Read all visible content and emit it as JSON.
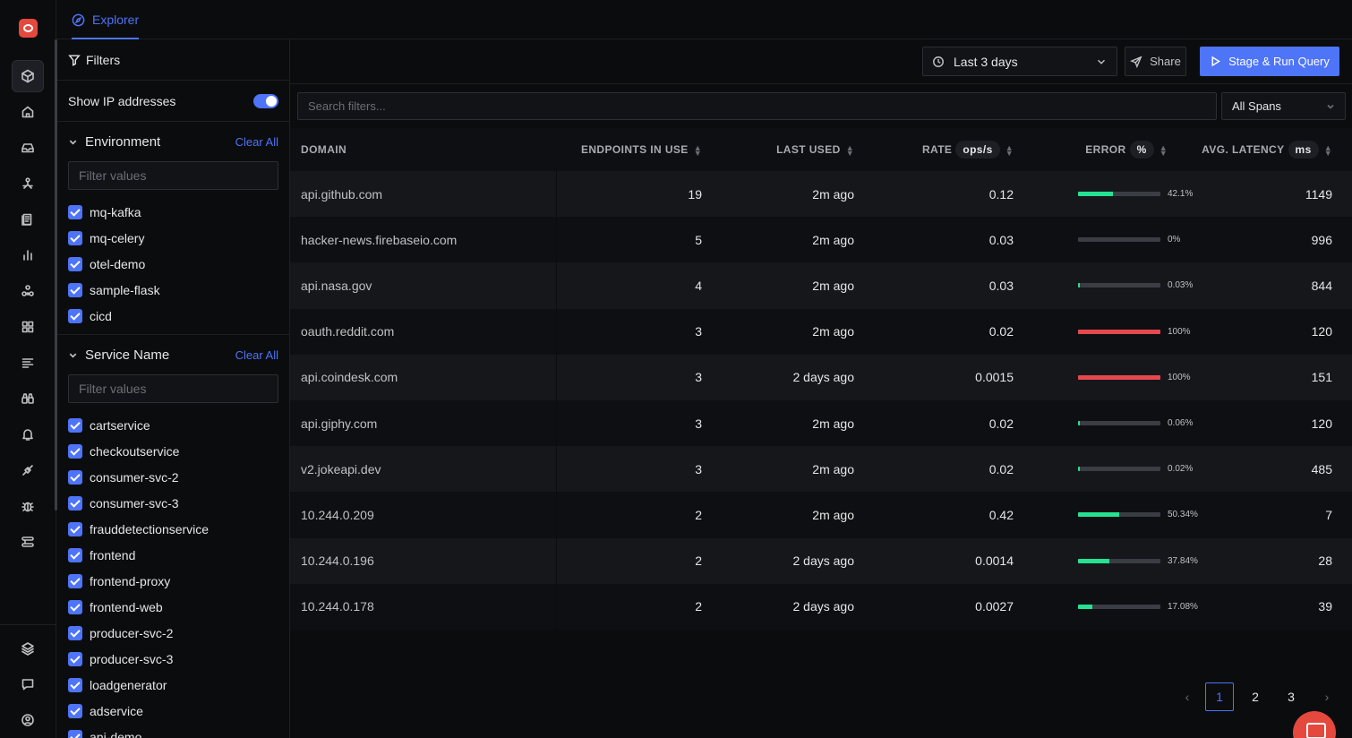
{
  "header": {
    "tab_label": "Explorer"
  },
  "filters": {
    "title": "Filters",
    "show_ip_label": "Show IP addresses",
    "show_ip_enabled": true,
    "environment": {
      "title": "Environment",
      "clear_label": "Clear All",
      "placeholder": "Filter values",
      "items": [
        "mq-kafka",
        "mq-celery",
        "otel-demo",
        "sample-flask",
        "cicd"
      ]
    },
    "service": {
      "title": "Service Name",
      "clear_label": "Clear All",
      "placeholder": "Filter values",
      "items": [
        "cartservice",
        "checkoutservice",
        "consumer-svc-2",
        "consumer-svc-3",
        "frauddetectionservice",
        "frontend",
        "frontend-proxy",
        "frontend-web",
        "producer-svc-2",
        "producer-svc-3",
        "loadgenerator",
        "adservice",
        "api-demo"
      ]
    }
  },
  "toolbar": {
    "time_range": "Last 3 days",
    "share_label": "Share",
    "run_label": "Stage & Run Query",
    "search_placeholder": "Search filters...",
    "spans_select": "All Spans"
  },
  "table": {
    "columns": {
      "domain": "DOMAIN",
      "endpoints": "ENDPOINTS IN USE",
      "last_used": "LAST USED",
      "rate": "RATE",
      "rate_unit": "ops/s",
      "error": "ERROR",
      "error_unit": "%",
      "latency": "AVG. LATENCY",
      "latency_unit": "ms"
    },
    "rows": [
      {
        "domain": "api.github.com",
        "endpoints": "19",
        "last_used": "2m ago",
        "rate": "0.12",
        "error": "42.1%",
        "error_frac": 0.421,
        "error_color": "#25e192",
        "latency": "1149"
      },
      {
        "domain": "hacker-news.firebaseio.com",
        "endpoints": "5",
        "last_used": "2m ago",
        "rate": "0.03",
        "error": "0%",
        "error_frac": 0,
        "error_color": "#25e192",
        "latency": "996"
      },
      {
        "domain": "api.nasa.gov",
        "endpoints": "4",
        "last_used": "2m ago",
        "rate": "0.03",
        "error": "0.03%",
        "error_frac": 0.0003,
        "error_color": "#25e192",
        "latency": "844"
      },
      {
        "domain": "oauth.reddit.com",
        "endpoints": "3",
        "last_used": "2m ago",
        "rate": "0.02",
        "error": "100%",
        "error_frac": 1,
        "error_color": "#e5484d",
        "latency": "120"
      },
      {
        "domain": "api.coindesk.com",
        "endpoints": "3",
        "last_used": "2 days ago",
        "rate": "0.0015",
        "error": "100%",
        "error_frac": 1,
        "error_color": "#e5484d",
        "latency": "151"
      },
      {
        "domain": "api.giphy.com",
        "endpoints": "3",
        "last_used": "2m ago",
        "rate": "0.02",
        "error": "0.06%",
        "error_frac": 0.006,
        "error_color": "#25e192",
        "latency": "120"
      },
      {
        "domain": "v2.jokeapi.dev",
        "endpoints": "3",
        "last_used": "2m ago",
        "rate": "0.02",
        "error": "0.02%",
        "error_frac": 0.0002,
        "error_color": "#25e192",
        "latency": "485"
      },
      {
        "domain": "10.244.0.209",
        "endpoints": "2",
        "last_used": "2m ago",
        "rate": "0.42",
        "error": "50.34%",
        "error_frac": 0.5034,
        "error_color": "#25e192",
        "latency": "7"
      },
      {
        "domain": "10.244.0.196",
        "endpoints": "2",
        "last_used": "2 days ago",
        "rate": "0.0014",
        "error": "37.84%",
        "error_frac": 0.3784,
        "error_color": "#25e192",
        "latency": "28"
      },
      {
        "domain": "10.244.0.178",
        "endpoints": "2",
        "last_used": "2 days ago",
        "rate": "0.0027",
        "error": "17.08%",
        "error_frac": 0.1708,
        "error_color": "#25e192",
        "latency": "39"
      }
    ]
  },
  "pagination": {
    "pages": [
      "1",
      "2",
      "3"
    ],
    "current": "1"
  },
  "icons": {
    "rail": [
      "logo-icon",
      "explorer-icon",
      "home-icon",
      "inbox-icon",
      "services-icon",
      "logs-icon",
      "chart-icon",
      "nodes-icon",
      "dashboard-icon",
      "list-icon",
      "binoculars-icon",
      "alert-bell-icon",
      "integrations-icon",
      "bug-icon",
      "pipelines-icon",
      "layers-icon",
      "message-icon",
      "user-icon"
    ]
  }
}
